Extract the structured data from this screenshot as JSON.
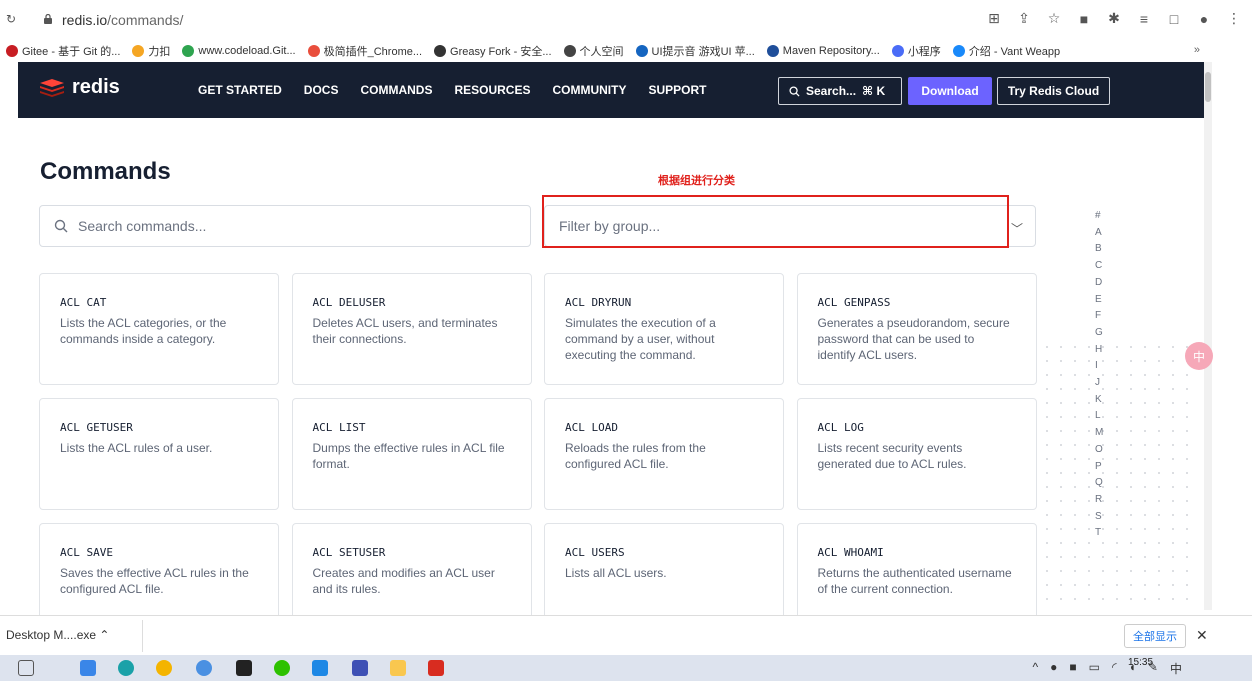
{
  "browser": {
    "url_host": "redis.io",
    "url_path": "/commands/",
    "bookmarks": [
      {
        "label": "Gitee - 基于 Git 的...",
        "color": "#c71d23"
      },
      {
        "label": "力扣",
        "color": "#f5a623"
      },
      {
        "label": "www.codeload.Git...",
        "color": "#2ea44f"
      },
      {
        "label": "极简插件_Chrome...",
        "color": "#e94e3c"
      },
      {
        "label": "Greasy Fork - 安全...",
        "color": "#333333"
      },
      {
        "label": "个人空间",
        "color": "#444444"
      },
      {
        "label": "UI提示音 游戏UI 苹...",
        "color": "#1565c0"
      },
      {
        "label": "Maven Repository...",
        "color": "#1f4e9a"
      },
      {
        "label": "小程序",
        "color": "#4a6cf7"
      },
      {
        "label": "介绍 - Vant Weapp",
        "color": "#1989fa"
      }
    ],
    "bookmarks_more": "»"
  },
  "nav": {
    "logo_text": "redis",
    "links": [
      "GET STARTED",
      "DOCS",
      "COMMANDS",
      "RESOURCES",
      "COMMUNITY",
      "SUPPORT"
    ],
    "search_label": "Search...",
    "search_shortcut": "⌘ K",
    "download_label": "Download",
    "cloud_label": "Try Redis Cloud"
  },
  "page": {
    "title": "Commands",
    "annotation": "根据组进行分类",
    "search_placeholder": "Search commands...",
    "filter_placeholder": "Filter by group..."
  },
  "commands": [
    {
      "name": "ACL CAT",
      "desc": "Lists the ACL categories, or the commands inside a category."
    },
    {
      "name": "ACL DELUSER",
      "desc": "Deletes ACL users, and terminates their connections."
    },
    {
      "name": "ACL DRYRUN",
      "desc": "Simulates the execution of a command by a user, without executing the command."
    },
    {
      "name": "ACL GENPASS",
      "desc": "Generates a pseudorandom, secure password that can be used to identify ACL users."
    },
    {
      "name": "ACL GETUSER",
      "desc": "Lists the ACL rules of a user."
    },
    {
      "name": "ACL LIST",
      "desc": "Dumps the effective rules in ACL file format."
    },
    {
      "name": "ACL LOAD",
      "desc": "Reloads the rules from the configured ACL file."
    },
    {
      "name": "ACL LOG",
      "desc": "Lists recent security events generated due to ACL rules."
    },
    {
      "name": "ACL SAVE",
      "desc": "Saves the effective ACL rules in the configured ACL file."
    },
    {
      "name": "ACL SETUSER",
      "desc": "Creates and modifies an ACL user and its rules."
    },
    {
      "name": "ACL USERS",
      "desc": "Lists all ACL users."
    },
    {
      "name": "ACL WHOAMI",
      "desc": "Returns the authenticated username of the current connection."
    }
  ],
  "alpha_index": [
    "#",
    "A",
    "B",
    "C",
    "D",
    "E",
    "F",
    "G",
    "H",
    "I",
    "J",
    "K",
    "L",
    "M",
    "O",
    "P",
    "Q",
    "R",
    "S",
    "T"
  ],
  "side_bubble": "中",
  "downloads": {
    "item": "Desktop M....exe",
    "show_all": "全部显示",
    "close": "✕"
  },
  "taskbar": {
    "time": "15:35",
    "ime": "中"
  },
  "colors": {
    "nav_bg": "#161f31",
    "download_btn": "#6c63ff",
    "annotation_red": "#e0211c"
  }
}
